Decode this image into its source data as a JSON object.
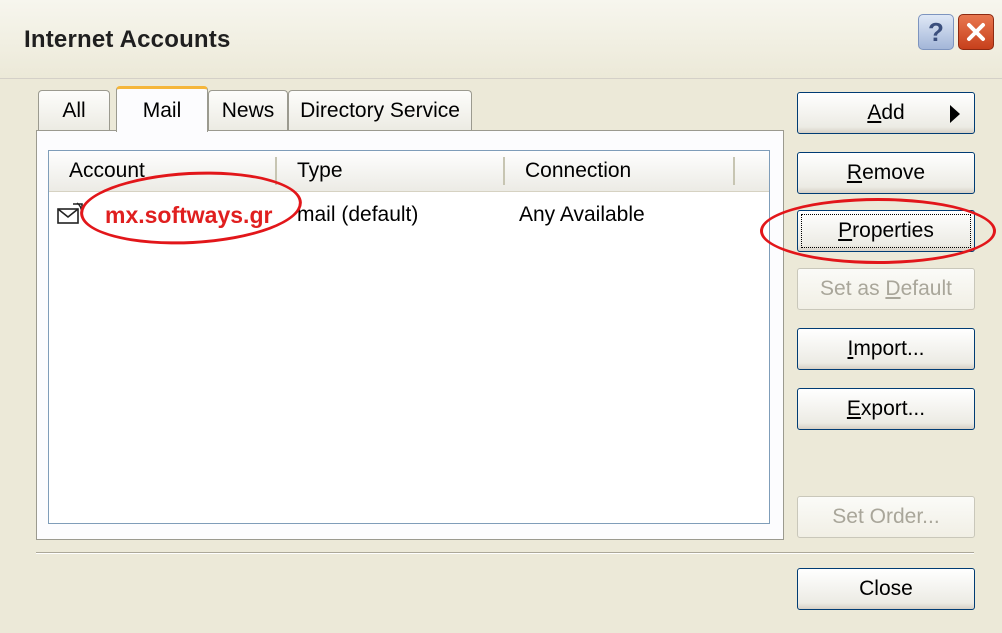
{
  "window": {
    "title": "Internet Accounts"
  },
  "tabs": [
    {
      "label": "All"
    },
    {
      "label": "Mail",
      "active": true
    },
    {
      "label": "News"
    },
    {
      "label": "Directory Service"
    }
  ],
  "list": {
    "columns": [
      "Account",
      "Type",
      "Connection"
    ],
    "rows": [
      {
        "account": "mx.softways.gr",
        "type": "mail (default)",
        "connection": "Any Available",
        "icon": "mail-account-icon"
      }
    ]
  },
  "buttons": {
    "add": {
      "u": "A",
      "rest": "dd"
    },
    "remove": {
      "u": "R",
      "rest": "emove"
    },
    "properties": {
      "u": "P",
      "rest": "roperties"
    },
    "set_default": {
      "pre": "Set as ",
      "u": "D",
      "rest": "efault"
    },
    "import": {
      "u": "I",
      "rest": "mport..."
    },
    "export": {
      "u": "E",
      "rest": "xport..."
    },
    "set_order": "Set Order...",
    "close": "Close"
  },
  "colors": {
    "highlight": "#e2161a",
    "account_text": "#e01f1f"
  }
}
